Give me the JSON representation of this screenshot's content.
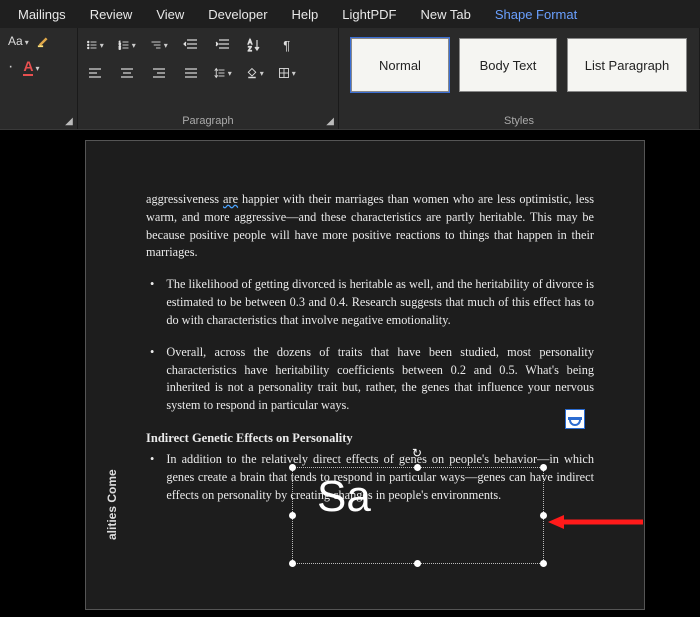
{
  "menu": {
    "items": [
      "Mailings",
      "Review",
      "View",
      "Developer",
      "Help",
      "LightPDF",
      "New Tab",
      "Shape Format"
    ],
    "active_index": 7
  },
  "ribbon": {
    "font": {
      "label": "Aa"
    },
    "paragraph": {
      "label": "Paragraph"
    },
    "styles": {
      "label": "Styles",
      "items": [
        "Normal",
        "Body Text",
        "List Paragraph"
      ],
      "selected_index": 0
    }
  },
  "document": {
    "para1_pre": "aggressiveness ",
    "para1_squiggle": "are",
    "para1_post": " happier with their marriages than women who are less optimistic, less warm, and more aggressive—and these characteristics are partly heritable. This may be because positive people will have more positive reactions to things that happen in their marriages.",
    "bullet1": "The likelihood of getting divorced is heritable as well, and the heritability of divorce is estimated to be between 0.3 and 0.4. Research suggests that much of this effect has to do with characteristics that involve negative emotionality.",
    "bullet2": "Overall, across the dozens of traits that have been studied, most personality characteristics have heritability coefficients between 0.2 and 0.5. What's being inherited is not a personality trait but, rather, the genes that influence your nervous system to respond in particular ways.",
    "heading": "Indirect Genetic Effects on Personality",
    "bullet3": "In addition to the relatively direct effects of genes on people's behavior—in which genes create a brain that tends to respond in particular ways—genes can have indirect effects on personality by creating changes in people's environments.",
    "vertical_label": "alities Come"
  },
  "textbox": {
    "content": "Sa"
  }
}
